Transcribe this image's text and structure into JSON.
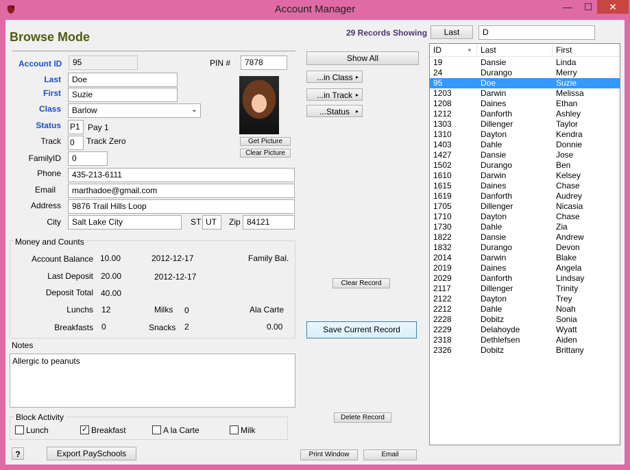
{
  "window": {
    "title": "Account Manager",
    "minimize": "—",
    "maximize": "☐",
    "close": "✕"
  },
  "mode_title": "Browse Mode",
  "records_showing": "29 Records Showing",
  "search": {
    "field_button": "Last",
    "value": "D"
  },
  "account": {
    "account_id_label": "Account ID",
    "account_id": "95",
    "pin_label": "PIN #",
    "pin": "7878",
    "last_label": "Last",
    "last": "Doe",
    "first_label": "First",
    "first": "Suzie",
    "class_label": "Class",
    "class": "Barlow",
    "status_label": "Status",
    "status_code": "P1",
    "status_text": "Pay 1",
    "track_label": "Track",
    "track_code": "0",
    "track_text": "Track Zero",
    "family_id_label": "FamilyID",
    "family_id": "0",
    "phone_label": "Phone",
    "phone": "435-213-6111",
    "email_label": "Email",
    "email": "marthadoe@gmail.com",
    "address_label": "Address",
    "address": "9876 Trail Hills Loop",
    "city_label": "City",
    "city": "Salt Lake City",
    "st_label": "ST",
    "st": "UT",
    "zip_label": "Zip",
    "zip": "84121"
  },
  "picture": {
    "get": "Get Picture",
    "clear": "Clear Picture"
  },
  "filters": {
    "show_all": "Show All",
    "in_class": "...in Class",
    "in_track": "...in Track",
    "status": "...Status"
  },
  "money": {
    "group_label": "Money and Counts",
    "account_balance_label": "Account Balance",
    "account_balance": "10.00",
    "account_balance_date": "2012-12-17",
    "family_bal_label": "Family Bal.",
    "last_deposit_label": "Last Deposit",
    "last_deposit": "20.00",
    "last_deposit_date": "2012-12-17",
    "deposit_total_label": "Deposit Total",
    "deposit_total": "40.00",
    "lunchs_label": "Lunchs",
    "lunchs": "12",
    "milks_label": "Milks",
    "milks": "0",
    "ala_carte_label": "Ala Carte",
    "breakfasts_label": "Breakfasts",
    "breakfasts": "0",
    "snacks_label": "Snacks",
    "snacks": "2",
    "ala_carte_value": "0.00"
  },
  "notes": {
    "label": "Notes",
    "text": "Allergic to peanuts"
  },
  "block": {
    "label": "Block Activity",
    "lunch": "Lunch",
    "breakfast": "Breakfast",
    "ala_carte": "A la Carte",
    "milk": "Milk",
    "breakfast_check": "✓"
  },
  "buttons": {
    "clear_record": "Clear Record",
    "save_record": "Save Current Record",
    "delete_record": "Delete Record",
    "help": "?",
    "export": "Export PaySchools",
    "print": "Print Window",
    "email": "Email"
  },
  "list": {
    "headers": {
      "id": "ID",
      "last": "Last",
      "first": "First"
    },
    "rows": [
      {
        "id": "19",
        "last": "Dansie",
        "first": "Linda"
      },
      {
        "id": "24",
        "last": "Durango",
        "first": "Merry"
      },
      {
        "id": "95",
        "last": "Doe",
        "first": "Suzie"
      },
      {
        "id": "1203",
        "last": "Darwin",
        "first": "Melissa"
      },
      {
        "id": "1208",
        "last": "Daines",
        "first": "Ethan"
      },
      {
        "id": "1212",
        "last": "Danforth",
        "first": "Ashley"
      },
      {
        "id": "1303",
        "last": "Dillenger",
        "first": "Taylor"
      },
      {
        "id": "1310",
        "last": "Dayton",
        "first": "Kendra"
      },
      {
        "id": "1403",
        "last": "Dahle",
        "first": "Donnie"
      },
      {
        "id": "1427",
        "last": "Dansie",
        "first": "Jose"
      },
      {
        "id": "1502",
        "last": "Durango",
        "first": "Ben"
      },
      {
        "id": "1610",
        "last": "Darwin",
        "first": "Kelsey"
      },
      {
        "id": "1615",
        "last": "Daines",
        "first": "Chase"
      },
      {
        "id": "1619",
        "last": "Danforth",
        "first": "Audrey"
      },
      {
        "id": "1705",
        "last": "Dillenger",
        "first": "Nicasia"
      },
      {
        "id": "1710",
        "last": "Dayton",
        "first": "Chase"
      },
      {
        "id": "1730",
        "last": "Dahle",
        "first": "Zia"
      },
      {
        "id": "1822",
        "last": "Dansie",
        "first": "Andrew"
      },
      {
        "id": "1832",
        "last": "Durango",
        "first": "Devon"
      },
      {
        "id": "2014",
        "last": "Darwin",
        "first": "Blake"
      },
      {
        "id": "2019",
        "last": "Daines",
        "first": "Angela"
      },
      {
        "id": "2029",
        "last": "Danforth",
        "first": "Lindsay"
      },
      {
        "id": "2117",
        "last": "Dillenger",
        "first": "Trinity"
      },
      {
        "id": "2122",
        "last": "Dayton",
        "first": "Trey"
      },
      {
        "id": "2212",
        "last": "Dahle",
        "first": "Noah"
      },
      {
        "id": "2228",
        "last": "Dobitz",
        "first": "Sonia"
      },
      {
        "id": "2229",
        "last": "Delahoyde",
        "first": "Wyatt"
      },
      {
        "id": "2318",
        "last": "Dethlefsen",
        "first": "Aiden"
      },
      {
        "id": "2326",
        "last": "Dobitz",
        "first": "Brittany"
      }
    ]
  }
}
